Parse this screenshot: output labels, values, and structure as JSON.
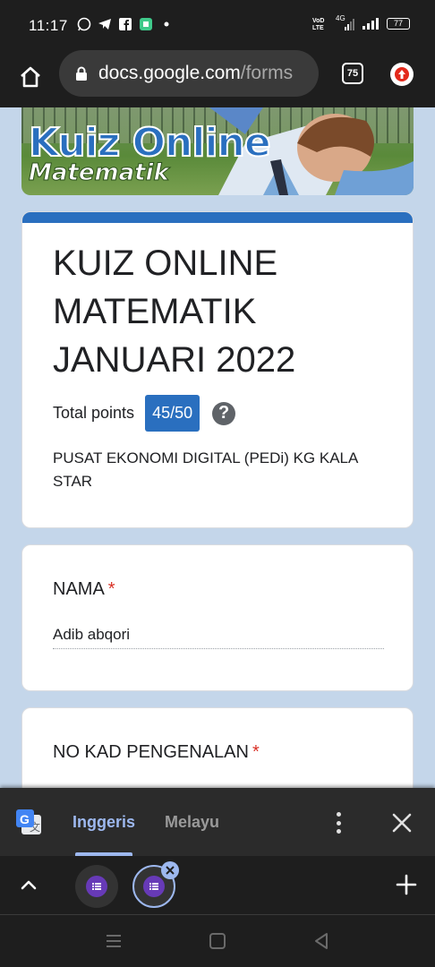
{
  "status": {
    "time": "11:17",
    "battery": "77",
    "network": "4G"
  },
  "browser": {
    "url_host": "docs.google.com",
    "url_path": "/forms",
    "tab_count": "75"
  },
  "banner": {
    "title": "Kuiz Online",
    "subtitle": "Matematik"
  },
  "form": {
    "title": "KUIZ ONLINE MATEMATIK JANUARI 2022",
    "points_label": "Total points",
    "points_value": "45/50",
    "help": "?",
    "description": "PUSAT EKONOMI DIGITAL (PEDi) KG KALA STAR",
    "accent_color": "#2a6fbf",
    "questions": [
      {
        "label": "NAMA",
        "required": "*",
        "answer": "Adib abqori"
      },
      {
        "label": "NO KAD PENGENALAN",
        "required": "*"
      }
    ]
  },
  "translate": {
    "source_lang": "Inggeris",
    "target_lang": "Melayu"
  },
  "icons": [
    "home-icon",
    "lock-icon",
    "update-icon",
    "google-translate-icon",
    "more-vert-icon",
    "close-icon",
    "chevron-up-icon",
    "forms-favicon",
    "plus-icon",
    "recents-icon",
    "home-nav-icon",
    "back-icon"
  ]
}
